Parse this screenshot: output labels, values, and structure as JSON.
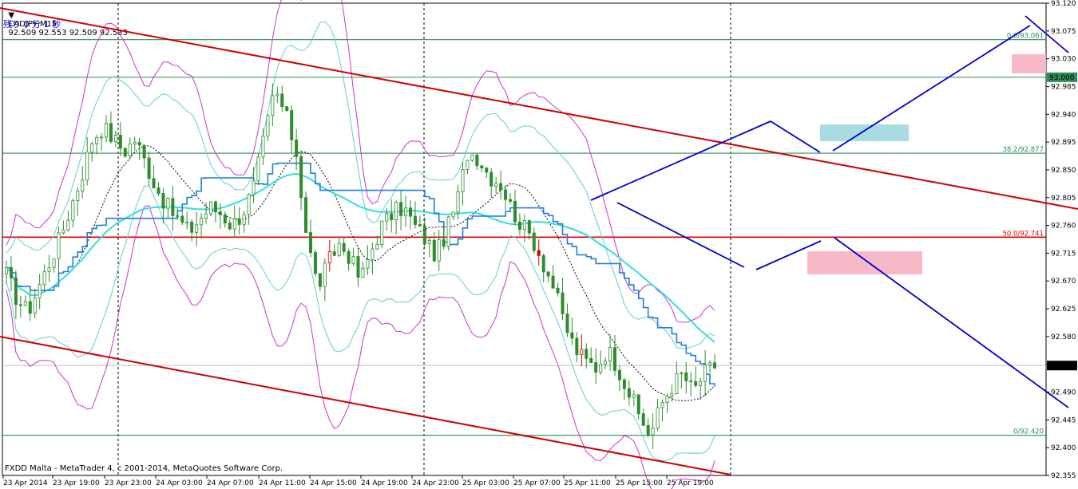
{
  "header": {
    "symbol": "CADJPY,M15",
    "ohlc": "92.509 92.553 92.509 92.533",
    "remaining": "残り 0 分 1 秒"
  },
  "footer": {
    "copyright": "FXDD Malta - MetaTrader 4, c 2001-2014, MetaQuotes Software Corp."
  },
  "colors": {
    "candle": "#2e8b2e",
    "bearish_emphasis": "#cc0000",
    "channel": "#cc0000",
    "fib_line": "#2e8b57",
    "fib_50": "#dd0000",
    "bollinger_outer": "#cc33cc",
    "bollinger_inner": "#66cccc",
    "ichimoku_kijun": "#1e7fd8",
    "ichimoku_tenkan": "#33dddd",
    "forecast": "#0000cc",
    "price_tag": "#000000",
    "level_tag": "#2e8b57",
    "zone_pink": "#f7b8c8",
    "zone_cyan": "#a8dce0"
  },
  "chart_data": {
    "type": "candlestick",
    "symbol": "CADJPY",
    "timeframe": "M15",
    "ylim": [
      92.355,
      93.12
    ],
    "yticks": [
      "93.120",
      "93.075",
      "93.030",
      "92.985",
      "92.940",
      "92.895",
      "92.850",
      "92.805",
      "92.760",
      "92.715",
      "92.670",
      "92.625",
      "92.580",
      "92.535",
      "92.490",
      "92.445",
      "92.400",
      "92.355"
    ],
    "xticks": [
      "23 Apr 2014",
      "23 Apr 19:00",
      "23 Apr 23:00",
      "24 Apr 03:00",
      "24 Apr 07:00",
      "24 Apr 11:00",
      "24 Apr 15:00",
      "24 Apr 19:00",
      "24 Apr 23:00",
      "25 Apr 03:00",
      "25 Apr 07:00",
      "25 Apr 11:00",
      "25 Apr 15:00",
      "25 Apr 19:00"
    ],
    "current_price": "92.533",
    "price_line_value": 92.533,
    "fib_levels": [
      {
        "label": "0.0/93.061",
        "value": 93.061
      },
      {
        "label": "38.2/92.877",
        "value": 92.877
      },
      {
        "label": "50.0/92.741",
        "value": 92.741
      },
      {
        "label": "0/92.420",
        "value": 92.42
      }
    ],
    "horizontal_levels": [
      {
        "label": "93.000",
        "value": 93.0
      }
    ],
    "close_path": [
      92.68,
      92.64,
      92.62,
      92.66,
      92.7,
      92.74,
      92.79,
      92.84,
      92.9,
      92.92,
      92.9,
      92.88,
      92.9,
      92.86,
      92.82,
      92.79,
      92.77,
      92.75,
      92.77,
      92.79,
      92.78,
      92.76,
      92.78,
      92.82,
      92.9,
      92.98,
      92.94,
      92.88,
      92.74,
      92.66,
      92.7,
      92.73,
      92.71,
      92.67,
      92.72,
      92.76,
      92.78,
      92.79,
      92.76,
      92.74,
      92.71,
      92.75,
      92.8,
      92.88,
      92.87,
      92.84,
      92.83,
      92.79,
      92.76,
      92.74,
      92.7,
      92.66,
      92.6,
      92.56,
      92.54,
      92.53,
      92.56,
      92.53,
      92.49,
      92.45,
      92.42,
      92.47,
      92.5,
      92.52,
      92.49,
      92.52,
      92.533
    ]
  }
}
